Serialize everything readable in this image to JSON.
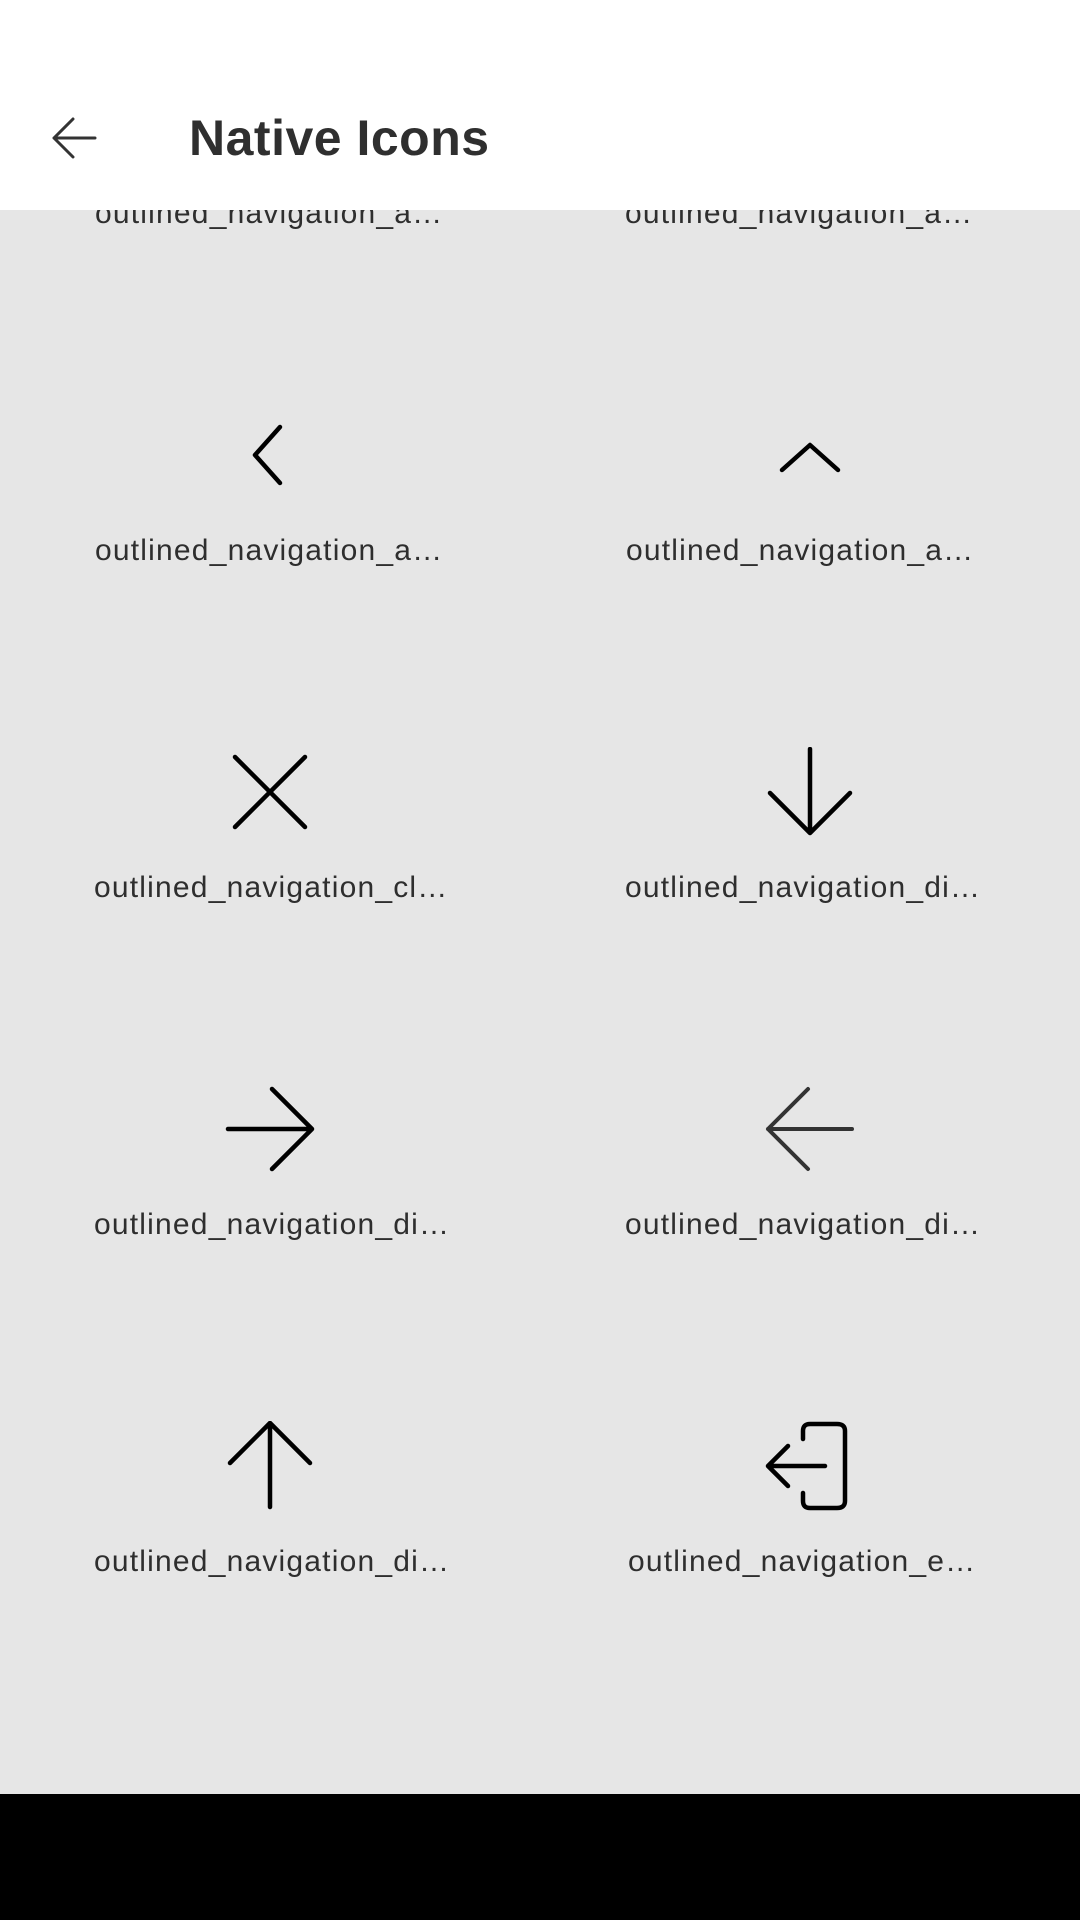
{
  "header": {
    "title": "Native Icons"
  },
  "grid": {
    "items": [
      {
        "label": "outlined_navigation_a…",
        "icon": "chevron-partial-icon"
      },
      {
        "label": "outlined_navigation_a…",
        "icon": "chevron-partial-icon"
      },
      {
        "label": "outlined_navigation_a…",
        "icon": "chevron-left-icon"
      },
      {
        "label": "outlined_navigation_a…",
        "icon": "chevron-up-icon"
      },
      {
        "label": "outlined_navigation_cl…",
        "icon": "close-icon"
      },
      {
        "label": "outlined_navigation_di…",
        "icon": "arrow-down-icon"
      },
      {
        "label": "outlined_navigation_di…",
        "icon": "arrow-right-icon"
      },
      {
        "label": "outlined_navigation_di…",
        "icon": "arrow-left-icon"
      },
      {
        "label": "outlined_navigation_di…",
        "icon": "arrow-up-icon"
      },
      {
        "label": "outlined_navigation_e…",
        "icon": "exit-icon"
      }
    ]
  },
  "colors": {
    "app_bar_bg": "#ffffff",
    "content_bg": "#e6e6e6",
    "icon_stroke": "#000000",
    "title_text": "#2f2f2f",
    "nav_bar_bg": "#000000"
  }
}
